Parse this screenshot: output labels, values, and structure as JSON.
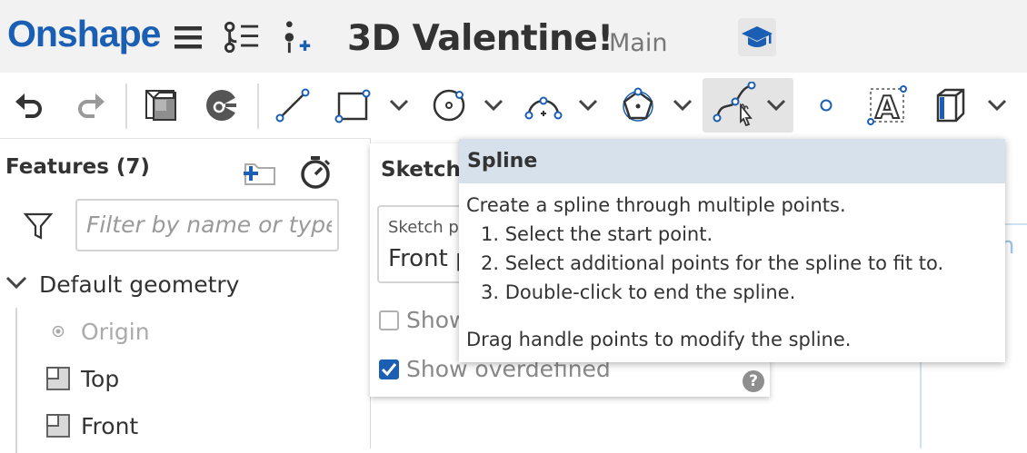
{
  "app": {
    "logo_text": "Onshape"
  },
  "header": {
    "document_title": "3D Valentine!",
    "branch": "Main",
    "icons": [
      "menu-icon",
      "versions-icon",
      "insert-icon",
      "learning-center-icon"
    ]
  },
  "toolbar": {
    "tools": [
      "undo-icon",
      "redo-icon",
      "view-cube-icon",
      "section-icon",
      "line-icon",
      "rectangle-icon",
      "circle-icon",
      "arc-icon",
      "polygon-icon",
      "spline-icon",
      "point-icon",
      "text-icon",
      "use-icon"
    ]
  },
  "features": {
    "title": "Features (7)",
    "filter_placeholder": "Filter by name or type",
    "group_label": "Default geometry",
    "items": [
      {
        "label": "Origin"
      },
      {
        "label": "Top"
      },
      {
        "label": "Front"
      }
    ]
  },
  "sketch_panel": {
    "title": "Sketch",
    "plane_label": "Sketch pl",
    "plane_value": "Front p",
    "show_constraints_label": "Show",
    "show_constraints_checked": false,
    "show_overdefined_label": "Show overdefined",
    "show_overdefined_checked": true,
    "help_label": "?"
  },
  "tooltip": {
    "title": "Spline",
    "description": "Create a spline through multiple points.",
    "steps": [
      "1. Select the start point.",
      "2. Select additional points for the spline to fit to.",
      "3. Double-click to end the spline."
    ],
    "footer": "Drag handle points to modify the spline."
  },
  "canvas": {
    "partial_text": "h"
  },
  "colors": {
    "brand": "#1a5fb4",
    "tooltip_header": "#d6e1ec",
    "toolbar_active": "#e4e4e4"
  }
}
